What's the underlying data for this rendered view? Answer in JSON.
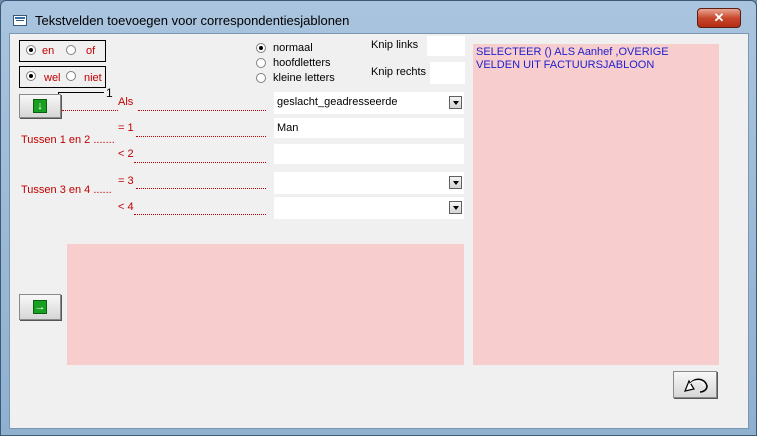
{
  "window": {
    "title": "Tekstvelden toevoegen voor correspondentiesjablonen",
    "close_label": "✕"
  },
  "options1": {
    "en": "en",
    "of": "of"
  },
  "options2": {
    "wel": "wel",
    "niet": "niet"
  },
  "marker_number": "1",
  "case": {
    "normaal": "normaal",
    "hoofdletters": "hoofdletters",
    "kleine": "kleine letters"
  },
  "knip": {
    "links": "Knip links",
    "rechts": "Knip rechts"
  },
  "labels": {
    "als": "Als",
    "eq1": "= 1",
    "lt2": "< 2",
    "eq3": "= 3",
    "lt4": "< 4",
    "tussen12": "Tussen 1 en 2 .......",
    "tussen34": "Tussen 3 en 4 ......"
  },
  "fields": {
    "als_value": "geslacht_geadresseerde",
    "eq1_value": "Man",
    "lt2_value": "",
    "eq3_value": "",
    "lt4_value": ""
  },
  "info_text": "SELECTEER () ALS Aanhef ,OVERIGE VELDEN UIT FACTUURSJABLOON",
  "colors": {
    "label_red": "#c00000",
    "info_blue": "#2020d0",
    "panel_pink": "#f8cdcd"
  }
}
